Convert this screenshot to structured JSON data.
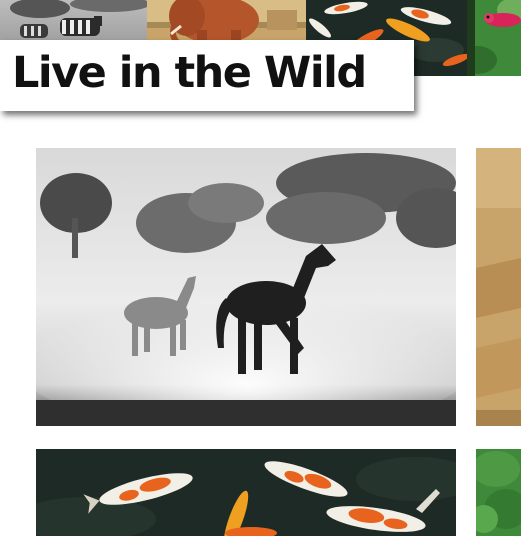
{
  "header": {
    "title": "Live in the Wild"
  },
  "strip": {
    "tiles": [
      {
        "subject": "zebras",
        "icon": "zebra-photo"
      },
      {
        "subject": "elephant",
        "icon": "elephant-photo"
      },
      {
        "subject": "koi fish",
        "icon": "koi-photo"
      },
      {
        "subject": "bird",
        "icon": "bird-photo"
      }
    ]
  },
  "gallery": {
    "cards": [
      {
        "subject": "horses running in dust",
        "icon": "horses-photo"
      },
      {
        "subject": "dry grass field",
        "icon": "field-photo"
      },
      {
        "subject": "koi fish pond",
        "icon": "koi-photo"
      },
      {
        "subject": "green foliage",
        "icon": "foliage-photo"
      }
    ]
  },
  "colors": {
    "background": "#ffffff",
    "title_text": "#111111",
    "savanna": "#c9a46a",
    "elephant": "#b5552c",
    "koi_water": "#1e2a26",
    "koi_orange": "#e8641e",
    "foliage": "#3f8a3a"
  }
}
